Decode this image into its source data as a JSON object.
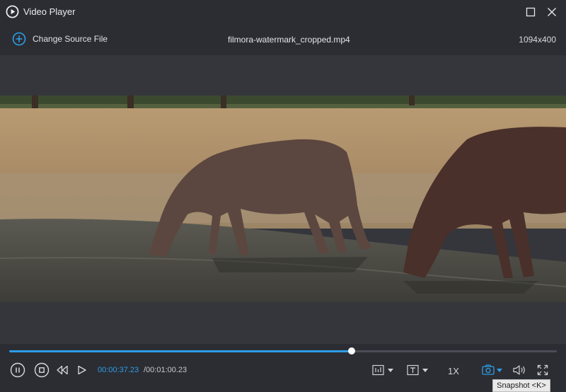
{
  "window": {
    "title": "Video Player",
    "app_icon": "play-circle-icon",
    "maximize_icon": "maximize-icon",
    "close_icon": "close-icon"
  },
  "source_bar": {
    "change_source_label": "Change Source File",
    "change_source_icon": "plus-circle-icon",
    "file_name": "filmora-watermark_cropped.mp4",
    "resolution": "1094x400"
  },
  "playback": {
    "progress": 0.625,
    "current_time": "00:00:37.23",
    "total_time": "/00:01:00.23",
    "speed": "1X"
  },
  "controls": {
    "pause_icon": "pause-icon",
    "stop_icon": "stop-icon",
    "prev_icon": "rewind-icon",
    "next_icon": "forward-icon",
    "audio_track_icon": "audio-track-icon",
    "subtitle_icon": "subtitle-icon",
    "snapshot_icon": "camera-icon",
    "volume_icon": "volume-icon",
    "fullscreen_icon": "fullscreen-icon"
  },
  "tooltip": {
    "text": "Snapshot <K>"
  },
  "colors": {
    "accent": "#2e9de6",
    "background": "#2b2d33",
    "video_area": "#34363c"
  }
}
